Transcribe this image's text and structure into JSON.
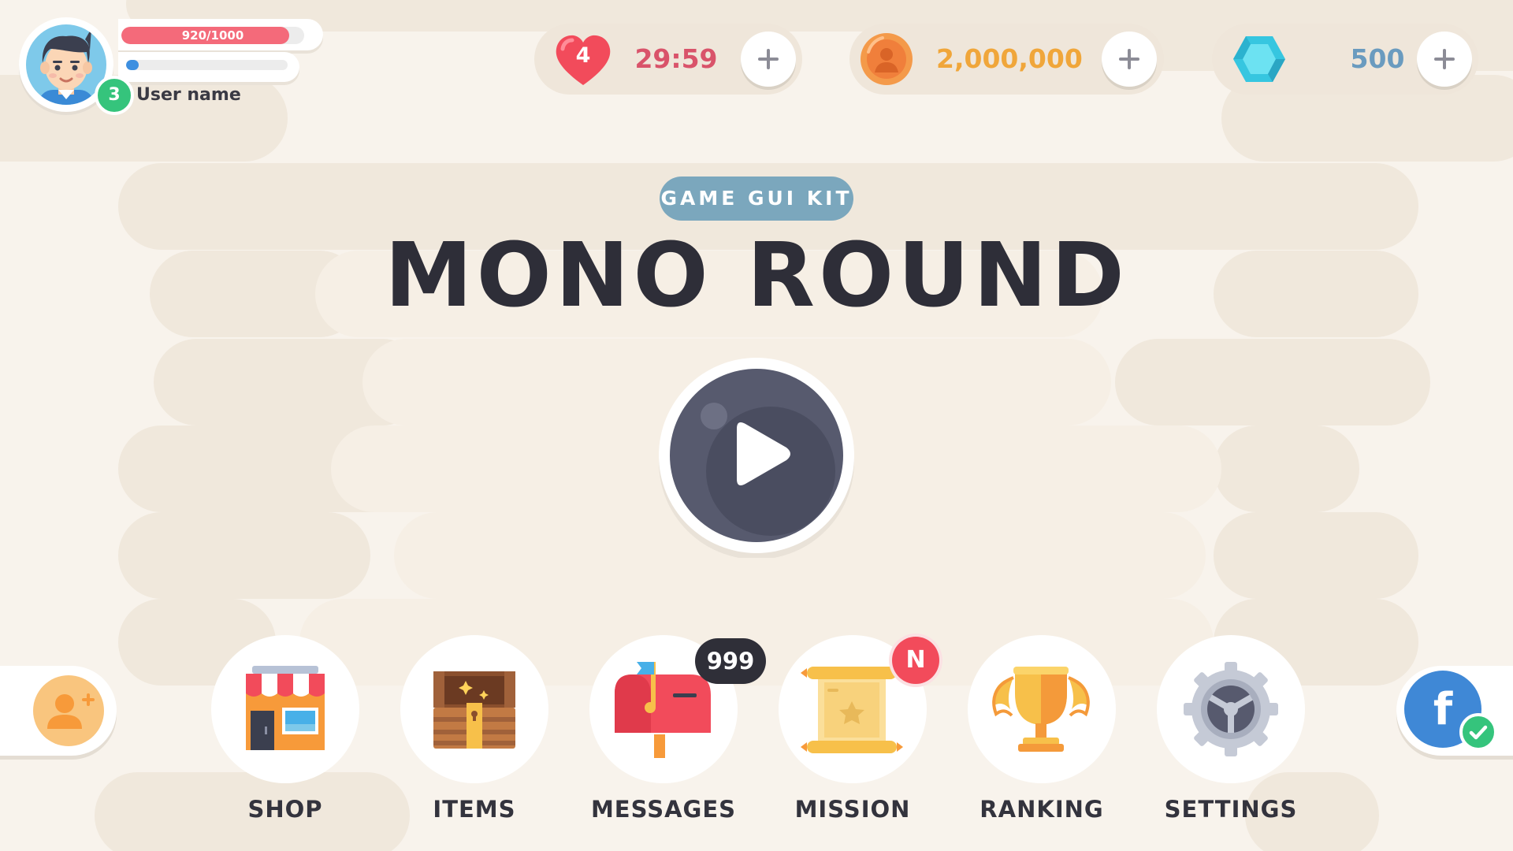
{
  "profile": {
    "xp_text": "920/1000",
    "xp_fraction": 0.92,
    "energy_fraction": 0.08,
    "level": "3",
    "username": "User name"
  },
  "resources": {
    "lives": {
      "count": "4",
      "timer": "29:59"
    },
    "coins": {
      "value": "2,000,000"
    },
    "gems": {
      "value": "500"
    }
  },
  "title": {
    "kit_label": "GAME GUI KIT",
    "game_title": "MONO ROUND"
  },
  "menu": {
    "shop": "SHOP",
    "items": "ITEMS",
    "messages": "MESSAGES",
    "messages_badge": "999",
    "mission": "MISSION",
    "mission_badge": "N",
    "ranking": "RANKING",
    "settings": "SETTINGS"
  },
  "social": {
    "facebook_glyph": "f"
  },
  "colors": {
    "background": "#f8f3ec",
    "blob": "#f0e8dc",
    "heart": "#f24b5b",
    "timer": "#d9536a",
    "coin_text": "#f0a63a",
    "gem_text": "#6a9bbf",
    "play": "#575a6e"
  },
  "icons": {
    "lives": "heart-icon",
    "coins": "coin-icon",
    "gems": "gem-icon",
    "add": "plus-icon",
    "play": "play-icon",
    "shop": "store-icon",
    "items": "treasure-chest-icon",
    "messages": "mailbox-icon",
    "mission": "scroll-icon",
    "ranking": "trophy-icon",
    "settings": "gear-icon",
    "add_friend": "add-user-icon",
    "facebook": "facebook-icon",
    "verified": "check-icon"
  }
}
